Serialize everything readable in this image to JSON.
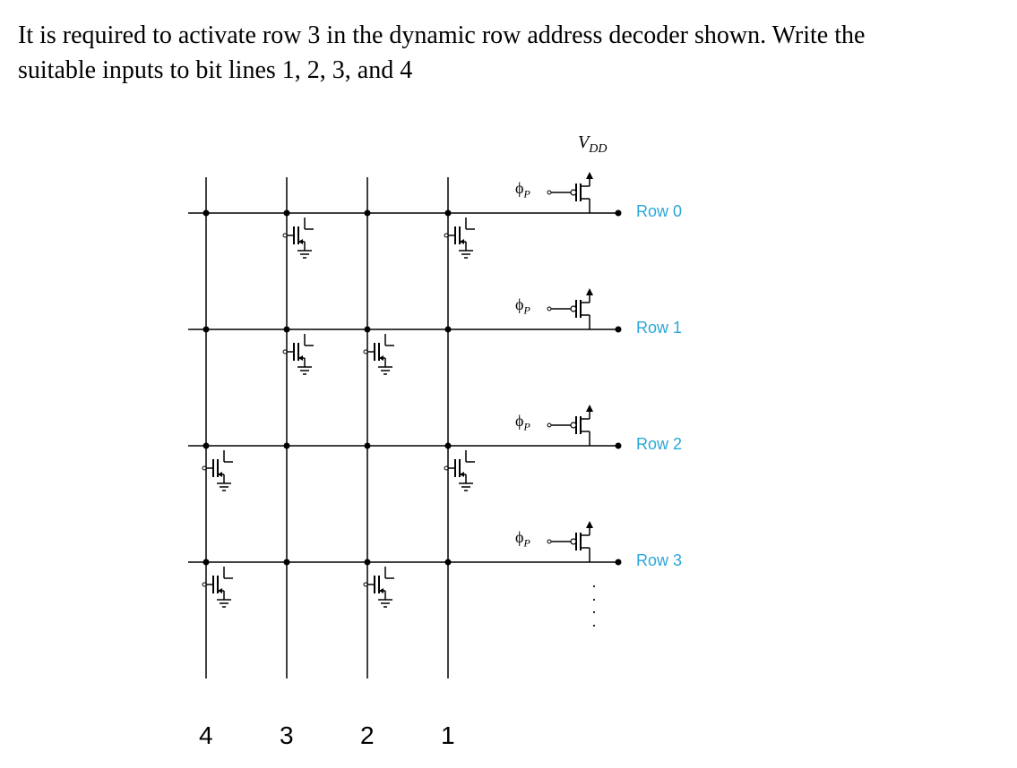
{
  "question": {
    "line1": "It is required to activate row 3 in the dynamic row address decoder shown. Write the",
    "line2": "suitable inputs to bit lines 1, 2, 3, and 4"
  },
  "labels": {
    "vdd": "V",
    "vdd_sub": "DD",
    "phi": "ϕ",
    "phi_sub": "P",
    "rows": [
      "Row 0",
      "Row 1",
      "Row 2",
      "Row 3"
    ],
    "bitlines": [
      "4",
      "3",
      "2",
      "1"
    ]
  },
  "circuit": {
    "description": "Dynamic NOR row address decoder with 4 bit lines and 4 rows",
    "rows": [
      {
        "name": "Row 0",
        "nmos_connections": [
          "bit3",
          "bit1"
        ]
      },
      {
        "name": "Row 1",
        "nmos_connections": [
          "bit3",
          "bit2"
        ]
      },
      {
        "name": "Row 2",
        "nmos_connections": [
          "bit4",
          "bit1"
        ]
      },
      {
        "name": "Row 3",
        "nmos_connections": [
          "bit4",
          "bit2"
        ]
      }
    ],
    "bitlines": [
      "bit1",
      "bit2",
      "bit3",
      "bit4"
    ]
  }
}
